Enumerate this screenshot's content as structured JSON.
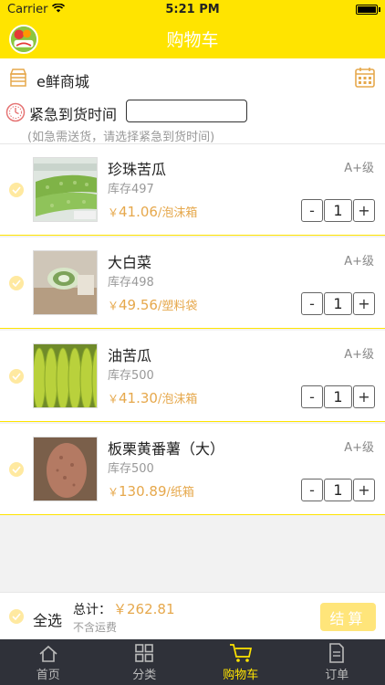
{
  "status": {
    "carrier": "Carrier",
    "time": "5:21 PM"
  },
  "nav": {
    "title": "购物车"
  },
  "shop": {
    "name": "e鲜商城"
  },
  "urgent": {
    "label": "紧急到货时间",
    "value": "",
    "hint": "(如急需送货，请选择紧急到货时间)"
  },
  "items": [
    {
      "name": "珍珠苦瓜",
      "grade": "A+级",
      "stock": "库存497",
      "price_symbol": "￥",
      "price": "41.06",
      "unit": "/泡沫箱",
      "qty": "1"
    },
    {
      "name": "大白菜",
      "grade": "A+级",
      "stock": "库存498",
      "price_symbol": "￥",
      "price": "49.56",
      "unit": "/塑料袋",
      "qty": "1"
    },
    {
      "name": "油苦瓜",
      "grade": "A+级",
      "stock": "库存500",
      "price_symbol": "￥",
      "price": "41.30",
      "unit": "/泡沫箱",
      "qty": "1"
    },
    {
      "name": "板栗黄番薯（大）",
      "grade": "A+级",
      "stock": "库存500",
      "price_symbol": "￥",
      "price": "130.89",
      "unit": "/纸箱",
      "qty": "1"
    }
  ],
  "stepper": {
    "minus": "-",
    "plus": "+"
  },
  "footer": {
    "select_all": "全选",
    "total_label": "总计：",
    "total_value": "￥262.81",
    "shipping": "不含运费",
    "checkout": "结算"
  },
  "tabs": [
    {
      "label": "首页",
      "icon": "home-icon"
    },
    {
      "label": "分类",
      "icon": "grid-icon"
    },
    {
      "label": "购物车",
      "icon": "cart-icon"
    },
    {
      "label": "订单",
      "icon": "document-icon"
    }
  ],
  "colors": {
    "accent": "#ffe400",
    "price": "#e6a84c",
    "tabbar": "#2f3139"
  }
}
